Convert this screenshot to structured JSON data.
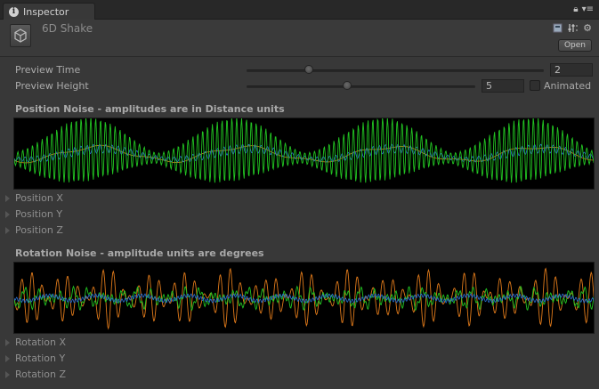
{
  "tab": {
    "icon": "info-icon",
    "label": "Inspector"
  },
  "header": {
    "title": "6D Shake",
    "open_label": "Open",
    "icons": [
      "script-icon",
      "settings-sliders-icon",
      "gear-icon"
    ]
  },
  "preview": {
    "time_label": "Preview Time",
    "time_value": "2",
    "time_fraction": 0.21,
    "height_label": "Preview Height",
    "height_value": "5",
    "height_fraction": 0.44,
    "animated_label": "Animated",
    "animated_checked": false
  },
  "position": {
    "title": "Position Noise - amplitudes are in Distance units",
    "items": [
      "Position X",
      "Position Y",
      "Position Z"
    ]
  },
  "rotation": {
    "title": "Rotation Noise - amplitude units are degrees",
    "items": [
      "Rotation X",
      "Rotation Y",
      "Rotation Z"
    ]
  },
  "colors": {
    "graph_bg": "#000000",
    "green": "#22c422",
    "blue": "#2a6fd6",
    "orange": "#e07a1a"
  }
}
